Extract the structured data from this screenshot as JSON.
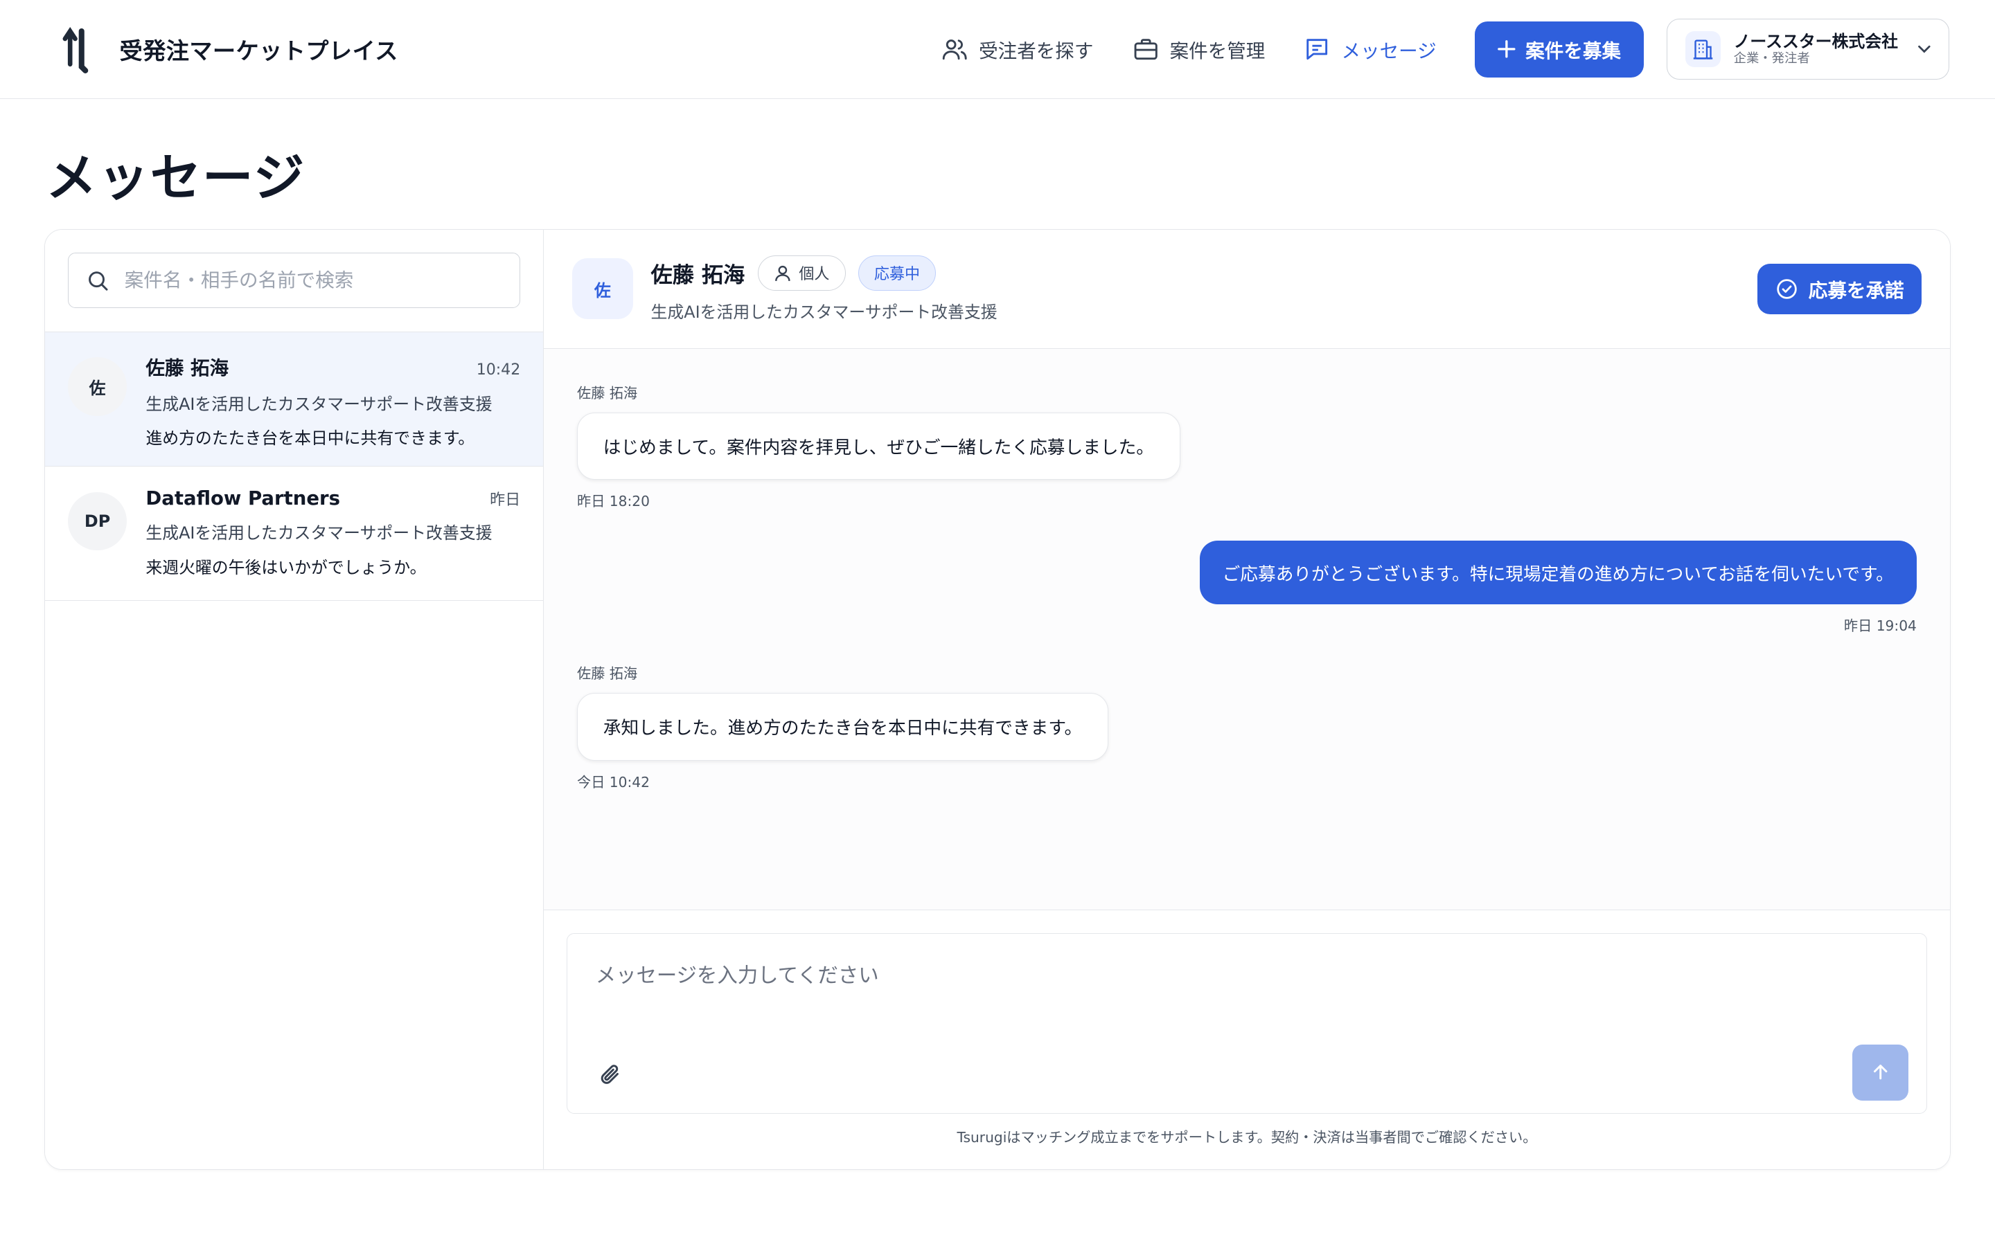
{
  "header": {
    "brand": "受発注マーケットプレイス",
    "nav": [
      {
        "label": "受注者を探す",
        "icon": "users-icon"
      },
      {
        "label": "案件を管理",
        "icon": "briefcase-icon"
      },
      {
        "label": "メッセージ",
        "icon": "chat-icon"
      }
    ],
    "post_button": "案件を募集",
    "account": {
      "name": "ノーススター株式会社",
      "role": "企業・発注者"
    }
  },
  "page": {
    "title": "メッセージ"
  },
  "sidebar": {
    "search_placeholder": "案件名・相手の名前で検索",
    "conversations": [
      {
        "avatar": "佐",
        "name": "佐藤 拓海",
        "time": "10:42",
        "project": "生成AIを活用したカスタマーサポート改善支援",
        "last_message": "進め方のたたき台を本日中に共有できます。"
      },
      {
        "avatar": "DP",
        "name": "Dataflow Partners",
        "time": "昨日",
        "project": "生成AIを活用したカスタマーサポート改善支援",
        "last_message": "来週火曜の午後はいかがでしょうか。"
      }
    ]
  },
  "chat": {
    "avatar": "佐",
    "name": "佐藤 拓海",
    "type_badge": "個人",
    "status_badge": "応募中",
    "project": "生成AIを活用したカスタマーサポート改善支援",
    "accept_button": "応募を承諾",
    "messages": [
      {
        "sender": "佐藤 拓海",
        "text": "はじめまして。案件内容を拝見し、ぜひご一緒したく応募しました。",
        "time": "昨日 18:20"
      },
      {
        "text": "ご応募ありがとうございます。特に現場定着の進め方についてお話を伺いたいです。",
        "time": "昨日 19:04"
      },
      {
        "sender": "佐藤 拓海",
        "text": "承知しました。進め方のたたき台を本日中に共有できます。",
        "time": "今日 10:42"
      }
    ],
    "composer_placeholder": "メッセージを入力してください",
    "footnote": "Tsurugiはマッチング成立までをサポートします。契約・決済は当事者間でご確認ください。"
  },
  "colors": {
    "accent": "#2f5fdc",
    "accent_light": "#e9effe",
    "send_disabled": "#9fb7ec"
  }
}
